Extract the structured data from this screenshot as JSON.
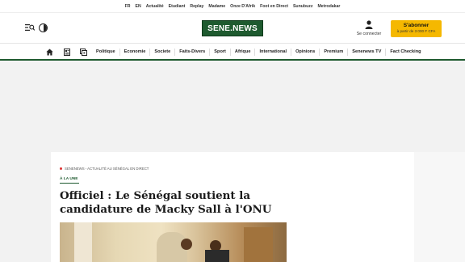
{
  "topbar": {
    "links": [
      "FR",
      "EN",
      "Actualité",
      "Etudiant",
      "Replay",
      "Madame",
      "Onze D'Afrik",
      "Foot en Direct",
      "Sunubuzz",
      "Metrodakar"
    ]
  },
  "header": {
    "logo_text": "SENE.NEWS",
    "login_label": "Se connecter",
    "subscribe_title": "S'abonner",
    "subscribe_subtitle": "à partir de 3 000 F CFA",
    "brand_color": "#1e5a2f",
    "accent_color": "#f5b800"
  },
  "nav": {
    "icons": [
      "home-icon",
      "newspaper-icon",
      "video-icon"
    ],
    "items": [
      "Politique",
      "Economie",
      "Societe",
      "Faits-Divers",
      "Sport",
      "Afrique",
      "International",
      "Opinions",
      "Premium",
      "Senenews TV",
      "Fact Checking"
    ]
  },
  "article": {
    "breadcrumb": "Senenews - Actualité au Sénégal en direct",
    "section_tag": "À LA UNE",
    "title": "Officiel : Le Sénégal soutient la candidature de Macky Sall à l'ONU"
  }
}
